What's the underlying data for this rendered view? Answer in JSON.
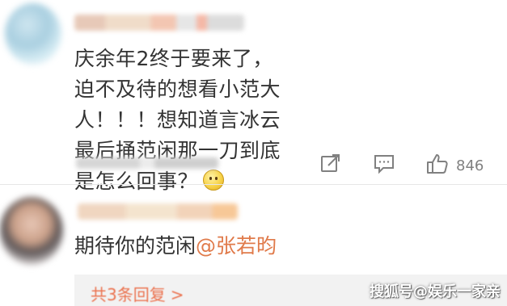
{
  "comment": {
    "avatar_icon": "user-avatar-blurred",
    "username": "",
    "text": "庆余年2终于要来了，迫不及待的想看小范大人！！！想知道言冰云最后捅范闲那一刀到底是怎么回事？",
    "emoji_icon": "thinking-face-emoji",
    "actions": {
      "repost_icon": "share-icon",
      "comment_icon": "comment-icon",
      "like_icon": "thumbs-up-icon",
      "like_count": "846"
    }
  },
  "reply": {
    "avatar_icon": "user-avatar-blurred",
    "username": "",
    "text_prefix": "期待你的范闲",
    "mention": "@张若昀"
  },
  "sub_replies": {
    "label": "共3条回复",
    "chevron": ">"
  },
  "watermark": "搜狐号@娱乐一家亲",
  "colors": {
    "text": "#333333",
    "icon": "#808080",
    "mention": "#e07a4a",
    "link": "#eb7350",
    "divider": "#e6e6e6"
  }
}
